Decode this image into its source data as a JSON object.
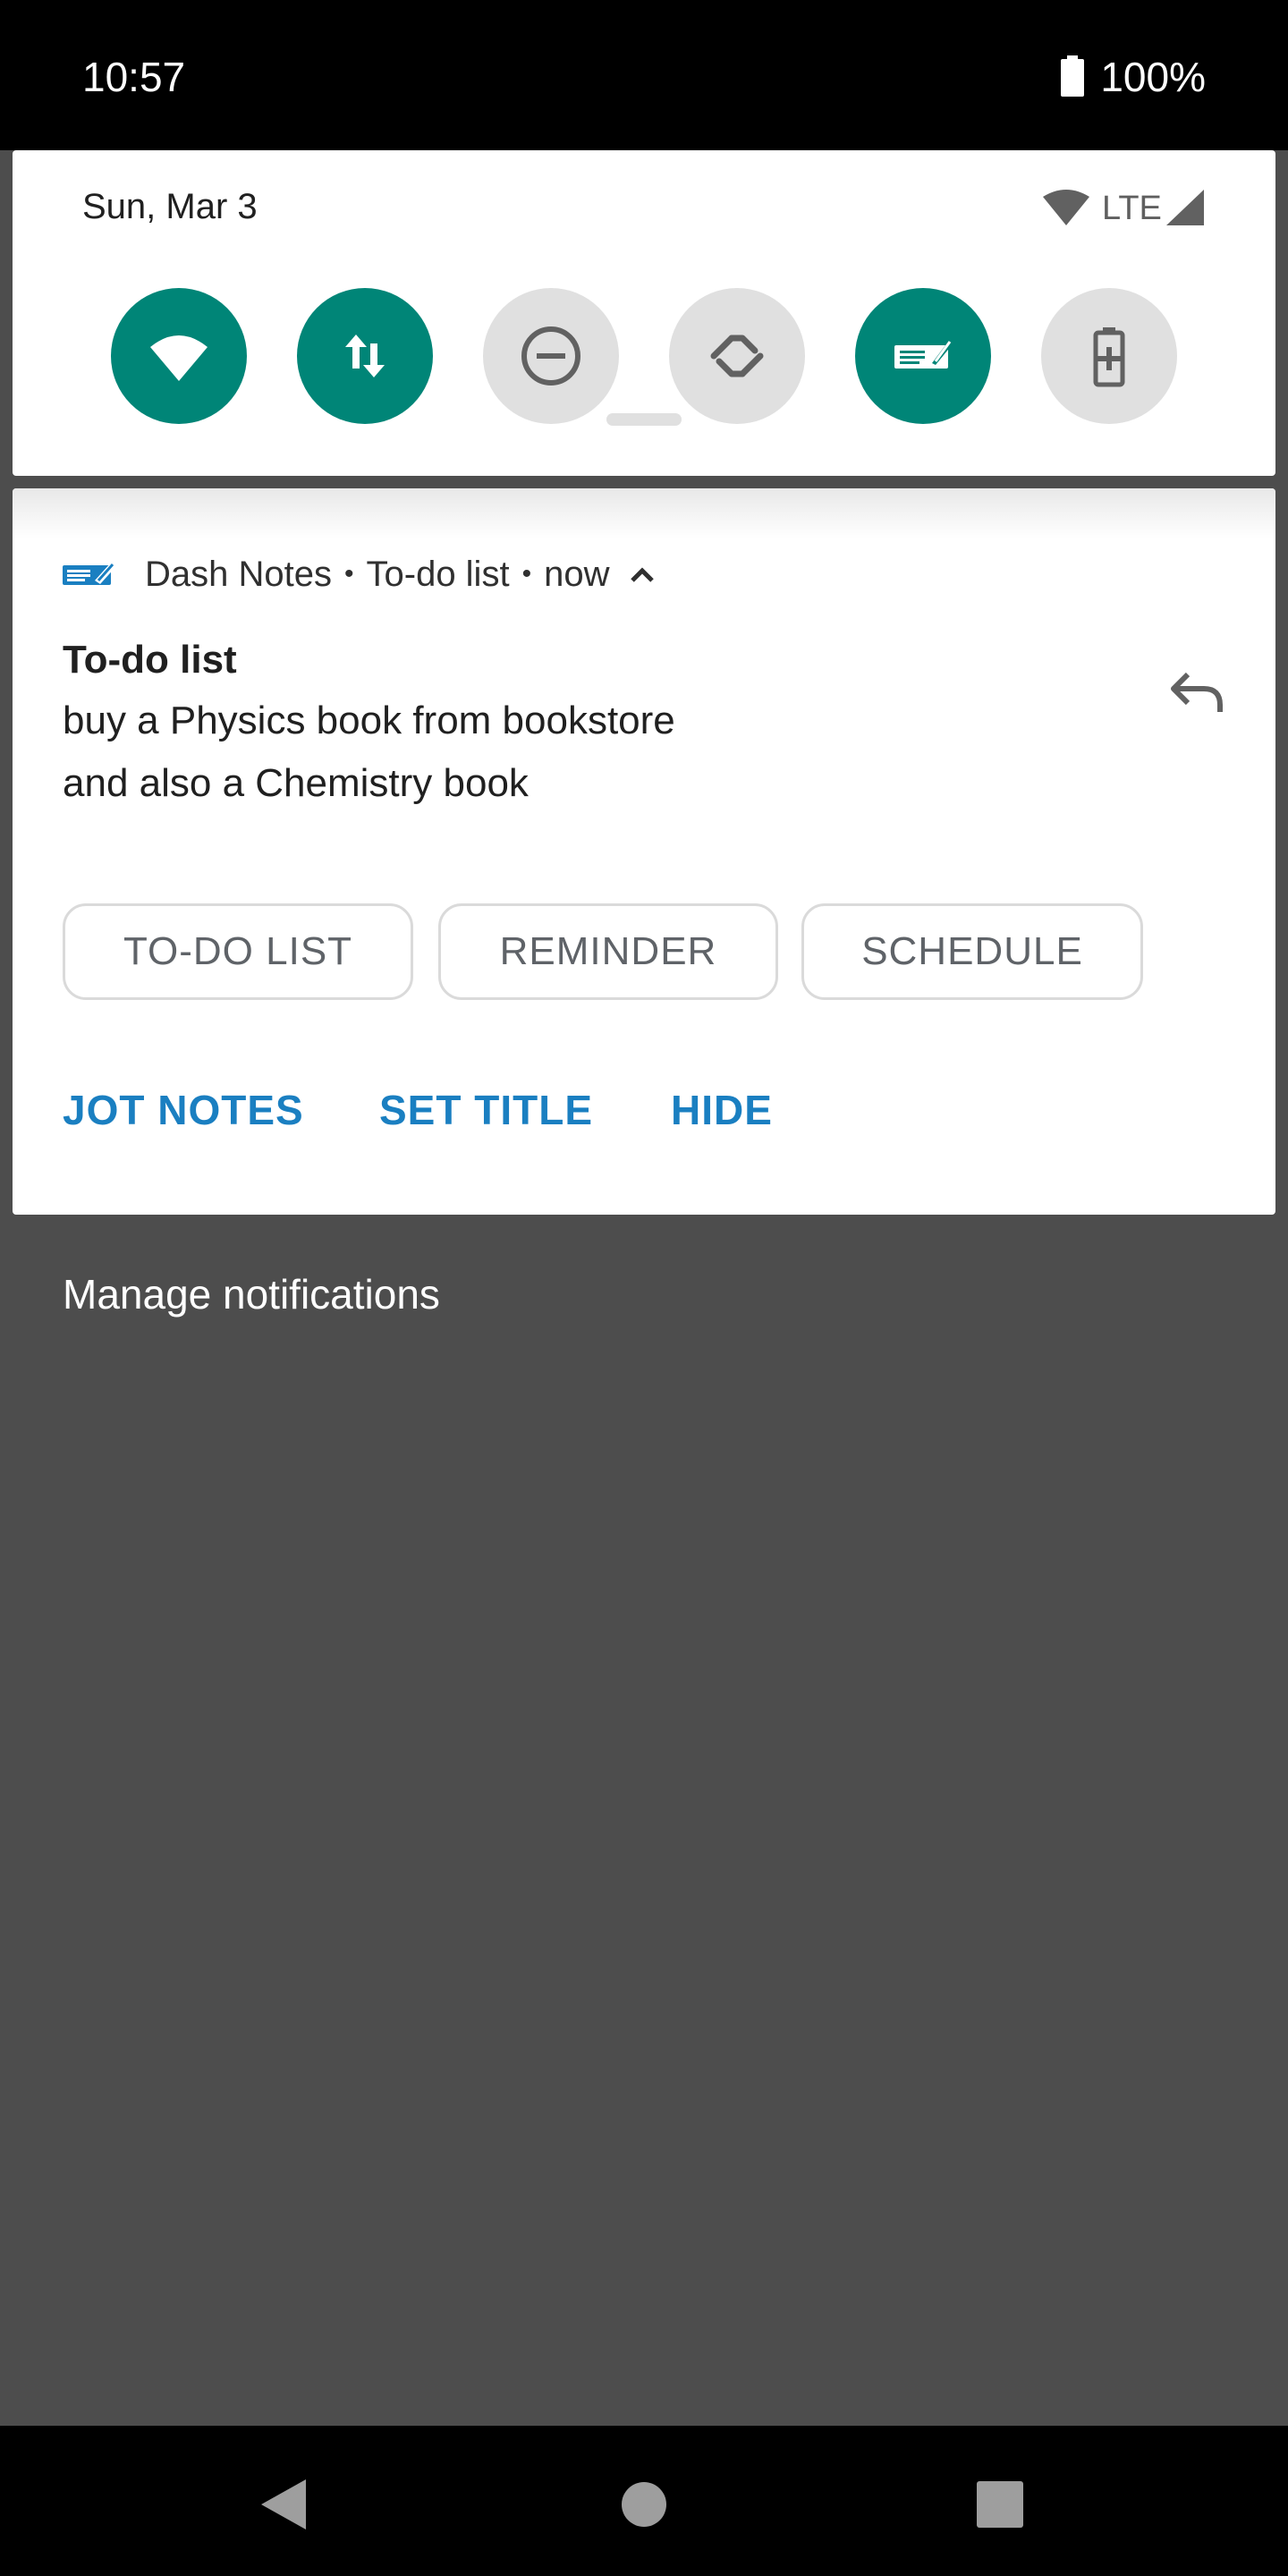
{
  "status_bar": {
    "time": "10:57",
    "battery_percent": "100%"
  },
  "quick_settings": {
    "date": "Sun, Mar 3",
    "network_type": "LTE",
    "tiles": [
      {
        "name": "wifi",
        "icon": "wifi-icon",
        "active": true
      },
      {
        "name": "mobile-data",
        "icon": "data-arrows-icon",
        "active": true
      },
      {
        "name": "do-not-disturb",
        "icon": "dnd-icon",
        "active": false
      },
      {
        "name": "auto-rotate",
        "icon": "rotate-icon",
        "active": false
      },
      {
        "name": "dash-notes",
        "icon": "notepad-icon",
        "active": true
      },
      {
        "name": "battery-saver",
        "icon": "battery-saver-icon",
        "active": false
      }
    ],
    "colors": {
      "active_tile": "#008577",
      "inactive_tile": "#e0e0e0"
    }
  },
  "notification": {
    "app_name": "Dash Notes",
    "channel": "To-do list",
    "time": "now",
    "title": "To-do list",
    "body_line1": "buy a Physics book from bookstore",
    "body_line2": "and also a Chemistry book",
    "chips": [
      "TO-DO LIST",
      "REMINDER",
      "SCHEDULE"
    ],
    "actions": [
      "JOT NOTES",
      "SET TITLE",
      "HIDE"
    ],
    "colors": {
      "action_text": "#1a7fc1",
      "app_icon": "#1a7fc1"
    }
  },
  "manage_notifications_label": "Manage notifications"
}
